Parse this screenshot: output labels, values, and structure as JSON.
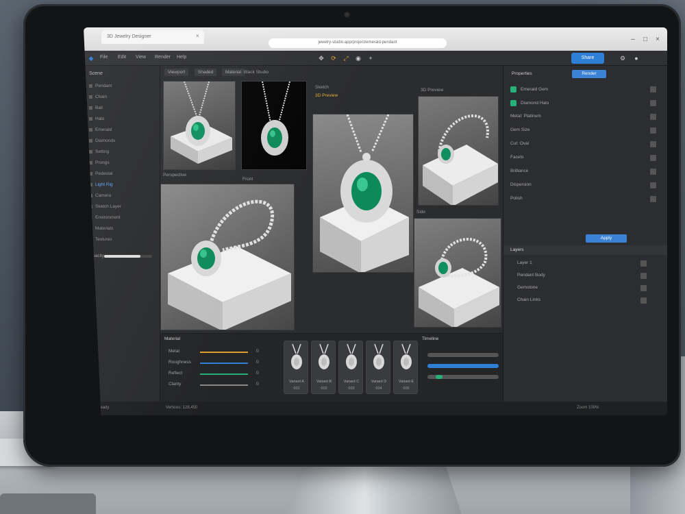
{
  "browser": {
    "tab_title": "3D Jewelry Designer",
    "url": "jewelry-studio.app/project/emerald-pendant"
  },
  "app": {
    "menu": [
      "File",
      "Edit",
      "View",
      "Render",
      "Help"
    ],
    "share_label": "Share",
    "toolbar_icons": [
      "move-icon",
      "rotate-icon",
      "scale-icon",
      "camera-icon",
      "plus-icon"
    ]
  },
  "left_panel": {
    "title": "Scene",
    "items": [
      "Pendant",
      "Chain",
      "Bail",
      "Halo",
      "Emerald",
      "Diamonds",
      "Setting",
      "Prongs",
      "Pedestal",
      "Light Rig",
      "Camera",
      "Sketch Layer",
      "Environment",
      "Materials",
      "Textures"
    ],
    "highlight_index": 9,
    "slider_label": "Opacity",
    "slider_value": 0.75
  },
  "canvas": {
    "tabs": [
      "Viewport",
      "Shaded",
      "Material"
    ],
    "view_labels": [
      "Perspective",
      "Black Studio",
      "Sketch",
      "3D Preview",
      "Front",
      "Side"
    ],
    "sketch_title": "3D Preview"
  },
  "right_panel": {
    "button_primary": "Render",
    "header": "Properties",
    "rows": [
      "Emerald Gem",
      "Diamond Halo",
      "Metal: Platinum",
      "Gem Size",
      "Cut: Oval",
      "Facets",
      "Brilliance",
      "Dispersion",
      "Polish"
    ],
    "layer_button": "Apply",
    "layers_title": "Layers",
    "layers": [
      "Layer 1",
      "Pendant Body",
      "Gemstone",
      "Chain Links"
    ]
  },
  "bottom": {
    "props_title": "Material",
    "props": [
      {
        "label": "Metal",
        "value": "0"
      },
      {
        "label": "Roughness",
        "value": "0"
      },
      {
        "label": "Reflect",
        "value": "0"
      },
      {
        "label": "Clarity",
        "value": "0"
      }
    ],
    "thumbnails": [
      {
        "label": "Variant A",
        "num": "001"
      },
      {
        "label": "Variant B",
        "num": "002"
      },
      {
        "label": "Variant C",
        "num": "003"
      },
      {
        "label": "Variant D",
        "num": "004"
      },
      {
        "label": "Variant E",
        "num": "005"
      }
    ],
    "timeline_title": "Timeline"
  },
  "status": {
    "left": "Ready",
    "middle": "Vertices: 128,450",
    "right": "Zoom 100%"
  },
  "colors": {
    "accent": "#2e7fd6",
    "emerald": "#14a06b",
    "panel": "#2b2c2e"
  }
}
